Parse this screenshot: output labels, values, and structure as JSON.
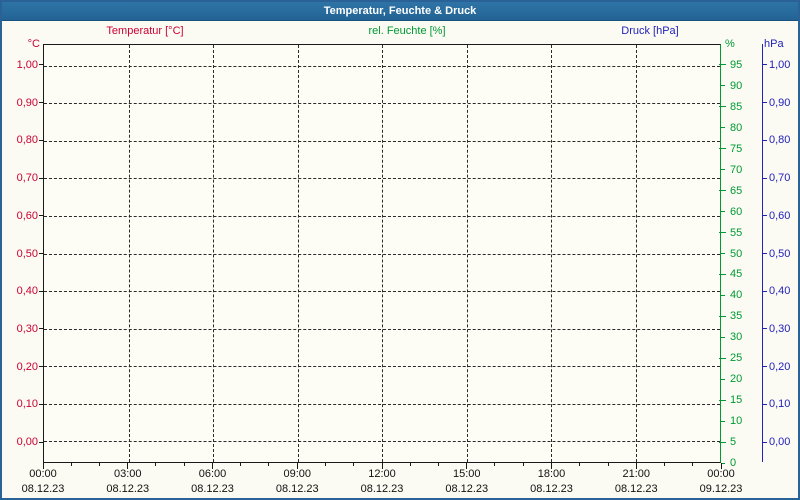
{
  "window": {
    "title": "Temperatur, Feuchte & Druck"
  },
  "legend": [
    {
      "label": "Temperatur [°C]",
      "color": "#cc0033"
    },
    {
      "label": "rel. Feuchte [%]",
      "color": "#009933"
    },
    {
      "label": "Druck [hPa]",
      "color": "#2222bb"
    }
  ],
  "axes": {
    "left": {
      "unit": "°C",
      "color": "#cc0033",
      "labels": [
        "1,00",
        "0,90",
        "0,80",
        "0,70",
        "0,60",
        "0,50",
        "0,40",
        "0,30",
        "0,20",
        "0,10",
        "0,00"
      ]
    },
    "percent": {
      "unit": "%",
      "color": "#009933",
      "labels": [
        "95",
        "90",
        "85",
        "80",
        "75",
        "70",
        "65",
        "60",
        "55",
        "50",
        "45",
        "40",
        "35",
        "30",
        "25",
        "20",
        "15",
        "10",
        "5",
        "0"
      ]
    },
    "pressure": {
      "unit": "hPa",
      "color": "#2222bb",
      "labels": [
        "1,00",
        "0,90",
        "0,80",
        "0,70",
        "0,60",
        "0,50",
        "0,40",
        "0,30",
        "0,20",
        "0,10",
        "0,00"
      ]
    }
  },
  "x_axis": {
    "ticks": [
      {
        "time": "00:00",
        "date": "08.12.23"
      },
      {
        "time": "03:00",
        "date": "08.12.23"
      },
      {
        "time": "06:00",
        "date": "08.12.23"
      },
      {
        "time": "09:00",
        "date": "08.12.23"
      },
      {
        "time": "12:00",
        "date": "08.12.23"
      },
      {
        "time": "15:00",
        "date": "08.12.23"
      },
      {
        "time": "18:00",
        "date": "08.12.23"
      },
      {
        "time": "21:00",
        "date": "08.12.23"
      },
      {
        "time": "00:00",
        "date": "09.12.23"
      }
    ]
  },
  "chart_data": {
    "type": "line",
    "title": "Temperatur, Feuchte & Druck",
    "x": {
      "tick_labels": [
        "00:00",
        "03:00",
        "06:00",
        "09:00",
        "12:00",
        "15:00",
        "18:00",
        "21:00",
        "00:00"
      ],
      "tick_dates": [
        "08.12.23",
        "08.12.23",
        "08.12.23",
        "08.12.23",
        "08.12.23",
        "08.12.23",
        "08.12.23",
        "08.12.23",
        "09.12.23"
      ],
      "range_hours": [
        0,
        24
      ],
      "minor_tick_hours": 1,
      "major_tick_hours": 3
    },
    "y_axes": [
      {
        "name": "Temperatur [°C]",
        "side": "left",
        "unit": "°C",
        "min": 0.0,
        "max": 1.0,
        "tick_step": 0.1,
        "tick_labels": [
          "0,00",
          "0,10",
          "0,20",
          "0,30",
          "0,40",
          "0,50",
          "0,60",
          "0,70",
          "0,80",
          "0,90",
          "1,00"
        ],
        "color": "#cc0033"
      },
      {
        "name": "rel. Feuchte [%]",
        "side": "right",
        "unit": "%",
        "min": 0,
        "max": 100,
        "tick_step": 5,
        "color": "#009933"
      },
      {
        "name": "Druck [hPa]",
        "side": "right",
        "unit": "hPa",
        "min": 0.0,
        "max": 1.0,
        "tick_step": 0.1,
        "color": "#2222bb"
      }
    ],
    "grid": {
      "horizontal_dashed_lines": 11,
      "vertical_dashed_lines": 7,
      "style": "dashed"
    },
    "legend_position": "top",
    "series": []
  }
}
